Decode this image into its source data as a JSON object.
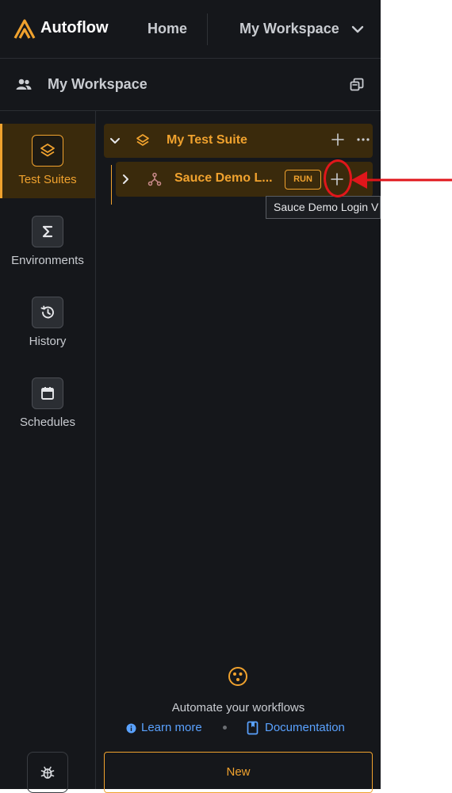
{
  "header": {
    "brand": "Autoflow",
    "nav_home": "Home",
    "workspace_switch": "My Workspace",
    "icons": {
      "logo": "autoflow-logo",
      "chevron": "chevron-down-icon"
    }
  },
  "workspace_bar": {
    "title": "My Workspace",
    "icons": {
      "people": "people-icon",
      "restore": "restore-window-icon"
    }
  },
  "rail": {
    "items": [
      {
        "label": "Test Suites",
        "icon": "layers-icon",
        "active": true
      },
      {
        "label": "Environments",
        "icon": "sigma-icon",
        "active": false
      },
      {
        "label": "History",
        "icon": "history-icon",
        "active": false
      },
      {
        "label": "Schedules",
        "icon": "calendar-icon",
        "active": false
      }
    ],
    "bottom_icon": "bug-icon"
  },
  "tree": {
    "suite": {
      "name": "My Test Suite",
      "expanded": true
    },
    "workflow": {
      "name": "Sauce Demo L...",
      "run_label": "RUN"
    },
    "tooltip": "Sauce Demo Login V"
  },
  "empty_state": {
    "icon": "cookie-icon",
    "text": "Automate your workflows",
    "learn_more": "Learn more",
    "documentation": "Documentation"
  },
  "new_button": "New",
  "colors": {
    "background": "#15171b",
    "accent": "#f0a22e",
    "accent_bg": "#3a2a0c",
    "link": "#5aa2ff",
    "annotation": "#e0161b"
  }
}
